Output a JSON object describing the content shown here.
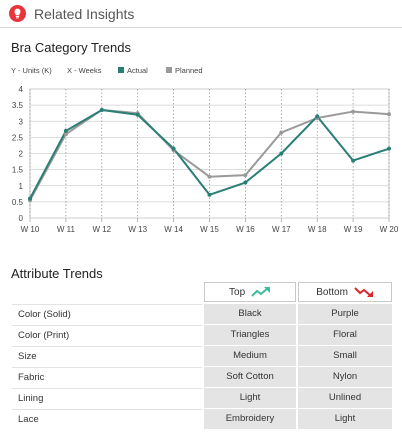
{
  "header": {
    "title": "Related Insights",
    "icon": "lightbulb-icon",
    "icon_color": "#e8343a"
  },
  "chart_section": {
    "title": "Bra Category Trends",
    "legend": {
      "y_label": "Y - Units (K)",
      "x_label": "X - Weeks",
      "actual": "Actual",
      "planned": "Planned"
    }
  },
  "chart_data": {
    "type": "line",
    "x": [
      "W 10",
      "W 11",
      "W 12",
      "W 13",
      "W 14",
      "W 15",
      "W 16",
      "W 17",
      "W 18",
      "W 19",
      "W 20"
    ],
    "ylim": [
      0,
      4
    ],
    "yticks": [
      0,
      0.5,
      1,
      1.5,
      2,
      2.5,
      3,
      3.5,
      4
    ],
    "grid": true,
    "series": [
      {
        "name": "Actual",
        "color": "#2a7f74",
        "values": [
          0.6,
          2.7,
          3.35,
          3.2,
          2.15,
          0.72,
          1.1,
          2.0,
          3.15,
          1.78,
          2.15
        ]
      },
      {
        "name": "Planned",
        "color": "#9a9a9a",
        "values": [
          0.55,
          2.6,
          3.35,
          3.25,
          2.1,
          1.28,
          1.33,
          2.65,
          3.1,
          3.3,
          3.22
        ]
      }
    ]
  },
  "attributes": {
    "title": "Attribute Trends",
    "top_label": "Top",
    "bottom_label": "Bottom",
    "top_color": "#3dbb9a",
    "bottom_color": "#d9262b",
    "rows": [
      {
        "label": "Color (Solid)",
        "top": "Black",
        "bottom": "Purple"
      },
      {
        "label": "Color (Print)",
        "top": "Triangles",
        "bottom": "Floral"
      },
      {
        "label": "Size",
        "top": "Medium",
        "bottom": "Small"
      },
      {
        "label": "Fabric",
        "top": "Soft Cotton",
        "bottom": "Nylon"
      },
      {
        "label": "Lining",
        "top": "Light",
        "bottom": "Unlined"
      },
      {
        "label": "Lace",
        "top": "Embroidery",
        "bottom": "Light"
      }
    ]
  }
}
